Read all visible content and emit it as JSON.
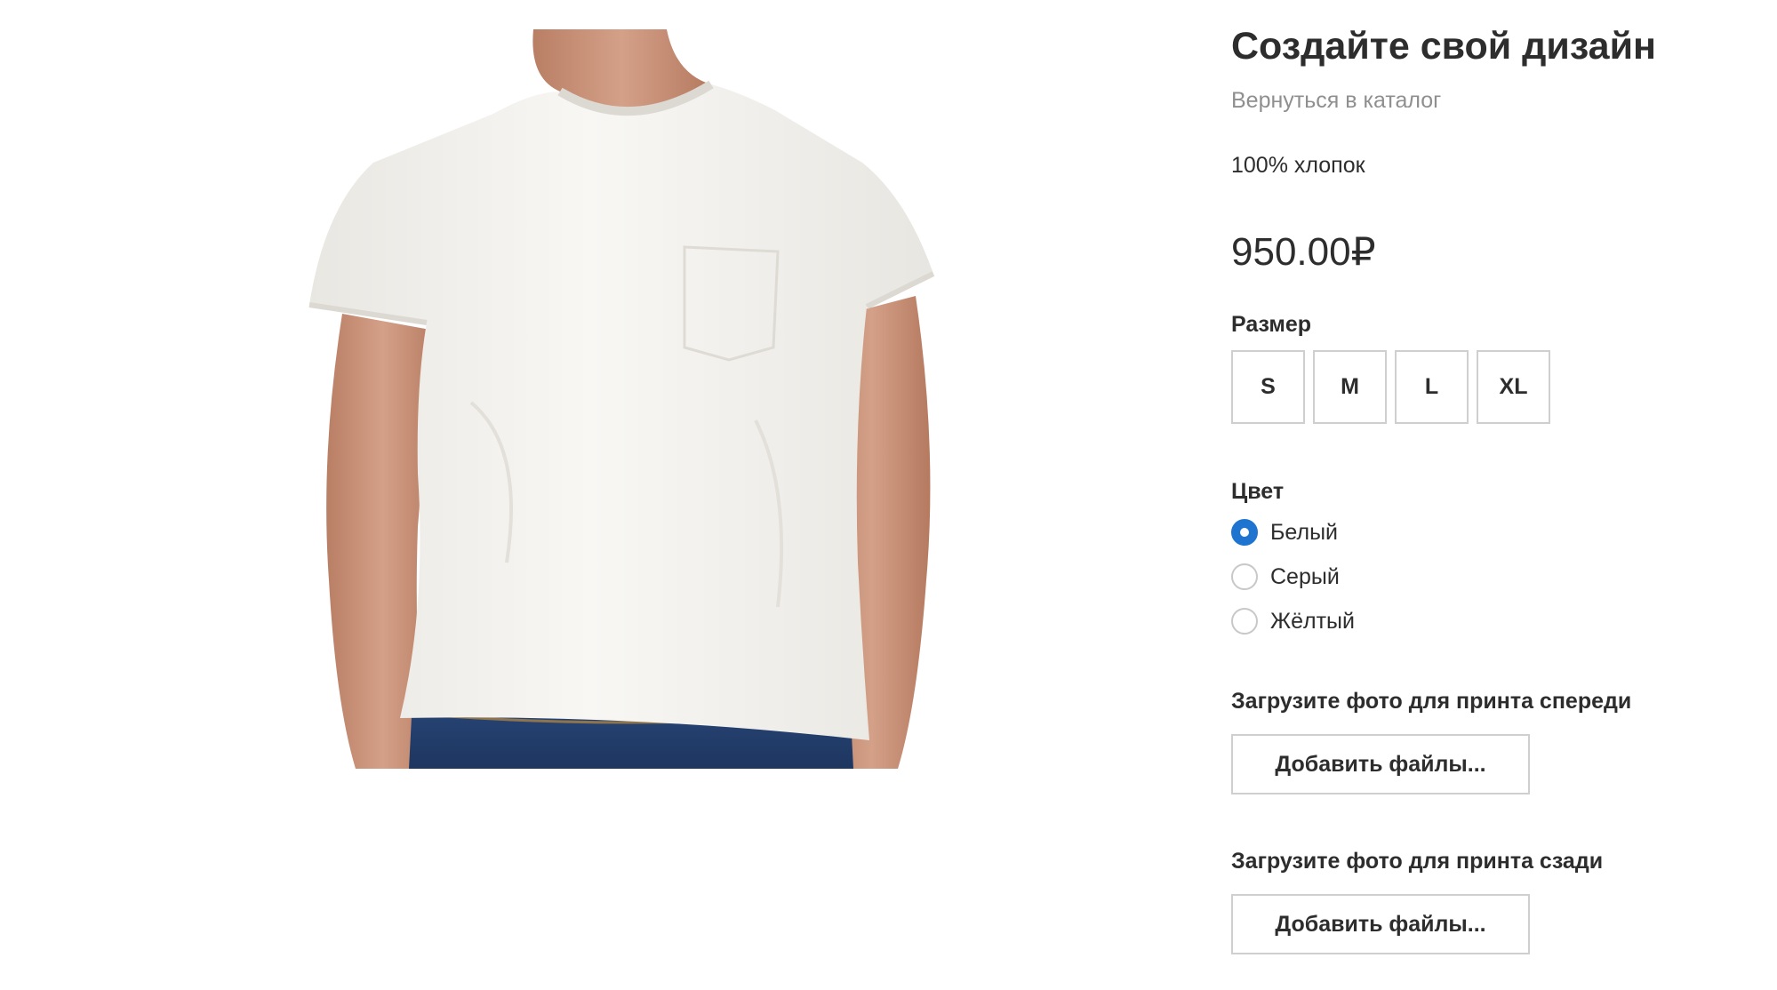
{
  "product": {
    "title": "Создайте свой дизайн",
    "back_link": "Вернуться в каталог",
    "material": "100% хлопок",
    "price": "950.00₽",
    "image_icon": "tshirt-photo"
  },
  "size": {
    "label": "Размер",
    "options": [
      "S",
      "M",
      "L",
      "XL"
    ]
  },
  "color": {
    "label": "Цвет",
    "options": [
      {
        "label": "Белый",
        "selected": true
      },
      {
        "label": "Серый",
        "selected": false
      },
      {
        "label": "Жёлтый",
        "selected": false
      }
    ],
    "accent": "#1f74d0"
  },
  "uploads": {
    "front_label": "Загрузите фото для принта спереди",
    "front_button": "Добавить файлы...",
    "back_label": "Загрузите фото для принта сзади",
    "back_button": "Добавить файлы..."
  }
}
